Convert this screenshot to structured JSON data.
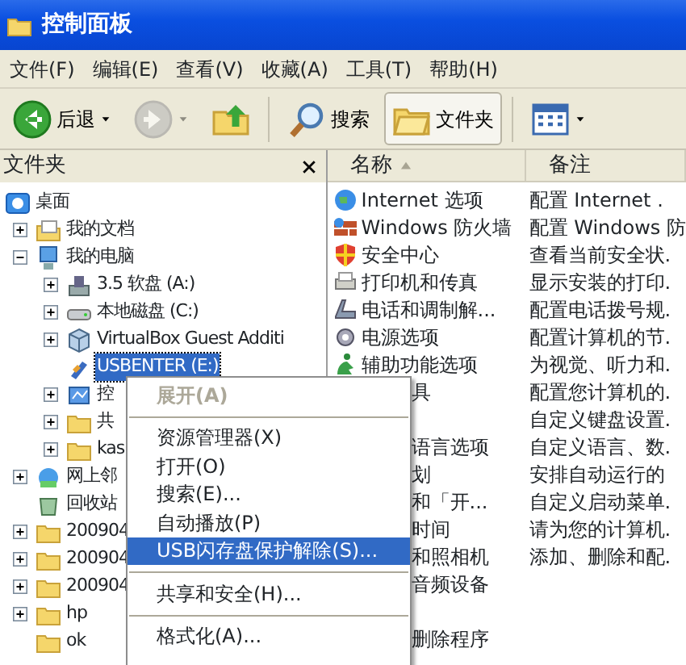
{
  "window": {
    "title": "控制面板"
  },
  "menu_bar": [
    "文件(F)",
    "编辑(E)",
    "查看(V)",
    "收藏(A)",
    "工具(T)",
    "帮助(H)"
  ],
  "toolbar": [
    {
      "kind": "back",
      "label": "后退",
      "disabled": false,
      "selected": false
    },
    {
      "kind": "forward",
      "disabled": true,
      "selected": false
    },
    {
      "kind": "up",
      "disabled": false,
      "selected": false
    },
    {
      "kind": "search",
      "label": "搜索",
      "disabled": false,
      "selected": false
    },
    {
      "kind": "folders",
      "label": "文件夹",
      "disabled": false,
      "selected": true
    },
    {
      "kind": "views",
      "disabled": false,
      "selected": false
    }
  ],
  "folder_pane": {
    "title": "文件夹",
    "tree": [
      {
        "label": "桌面",
        "selected": false,
        "children": [
          {
            "label": "我的文档",
            "expanded": false,
            "selected": false
          },
          {
            "label": "我的电脑",
            "expanded": true,
            "selected": false,
            "children": [
              {
                "label": "3.5 软盘 (A:)",
                "expanded": false,
                "selected": false
              },
              {
                "label": "本地磁盘 (C:)",
                "expanded": false,
                "selected": false
              },
              {
                "label": "VirtualBox Guest Additi",
                "expanded": false,
                "selected": false
              },
              {
                "label": "USBENTER (E:)",
                "selected": true
              },
              {
                "label": "控",
                "expanded": false,
                "selected": false
              },
              {
                "label": "共",
                "expanded": false,
                "selected": false
              },
              {
                "label": "kas",
                "expanded": false,
                "selected": false
              }
            ]
          },
          {
            "label": "网上邻",
            "expanded": false,
            "selected": false
          },
          {
            "label": "回收站",
            "selected": false
          },
          {
            "label": "200904",
            "expanded": false,
            "selected": false
          },
          {
            "label": "200904",
            "expanded": false,
            "selected": false
          },
          {
            "label": "200904",
            "expanded": false,
            "selected": false
          },
          {
            "label": "hp",
            "expanded": false,
            "selected": false
          },
          {
            "label": "ok",
            "selected": false
          }
        ]
      }
    ]
  },
  "list": {
    "columns": [
      {
        "label": "名称",
        "sorted": true
      },
      {
        "label": "备注",
        "sorted": false
      }
    ],
    "rows": [
      {
        "kind": "full",
        "name": "Internet 选项",
        "note": "配置 Internet ."
      },
      {
        "kind": "full",
        "name": "Windows 防火墙",
        "note": "配置 Windows 防"
      },
      {
        "kind": "full",
        "name": "安全中心",
        "note": "查看当前安全状."
      },
      {
        "kind": "full",
        "name": "打印机和传真",
        "note": "显示安装的打印."
      },
      {
        "kind": "full",
        "name": "电话和调制解...",
        "note": "配置电话拨号规."
      },
      {
        "kind": "full",
        "name": "电源选项",
        "note": "配置计算机的节."
      },
      {
        "kind": "full",
        "name": "辅助功能选项",
        "note": "为视觉、听力和."
      },
      {
        "kind": "covered",
        "name": "具",
        "note": "配置您计算机的."
      },
      {
        "kind": "covered",
        "note": "自定义键盘设置."
      },
      {
        "kind": "covered",
        "name": "语言选项",
        "note": "自定义语言、数."
      },
      {
        "kind": "covered",
        "name": "划",
        "note": "安排自动运行的"
      },
      {
        "kind": "covered",
        "name": "和「开...",
        "note": "自定义启动菜单."
      },
      {
        "kind": "covered",
        "name": "时间",
        "note": "请为您的计算机."
      },
      {
        "kind": "covered",
        "name": "和照相机",
        "note": "添加、删除和配."
      },
      {
        "kind": "covered",
        "name": "音频设备"
      },
      {
        "kind": "blank"
      },
      {
        "kind": "covered",
        "name": "删除程序"
      }
    ]
  },
  "context_menu": [
    {
      "kind": "item",
      "label": "展开(A)",
      "default": true,
      "disabled": true,
      "selected": false
    },
    {
      "kind": "separator"
    },
    {
      "kind": "item",
      "label": "资源管理器(X)",
      "default": false,
      "disabled": false,
      "selected": false
    },
    {
      "kind": "item",
      "label": "打开(O)",
      "default": false,
      "disabled": false,
      "selected": false
    },
    {
      "kind": "item",
      "label": "搜索(E)...",
      "default": false,
      "disabled": false,
      "selected": false
    },
    {
      "kind": "item",
      "label": "自动播放(P)",
      "default": false,
      "disabled": false,
      "selected": false
    },
    {
      "kind": "item",
      "label": "USB闪存盘保护解除(S)...",
      "default": false,
      "disabled": false,
      "selected": true
    },
    {
      "kind": "separator"
    },
    {
      "kind": "item",
      "label": "共享和安全(H)...",
      "default": false,
      "disabled": false,
      "selected": false
    },
    {
      "kind": "separator"
    },
    {
      "kind": "item",
      "label": "格式化(A)...",
      "default": false,
      "disabled": false,
      "selected": false
    }
  ]
}
